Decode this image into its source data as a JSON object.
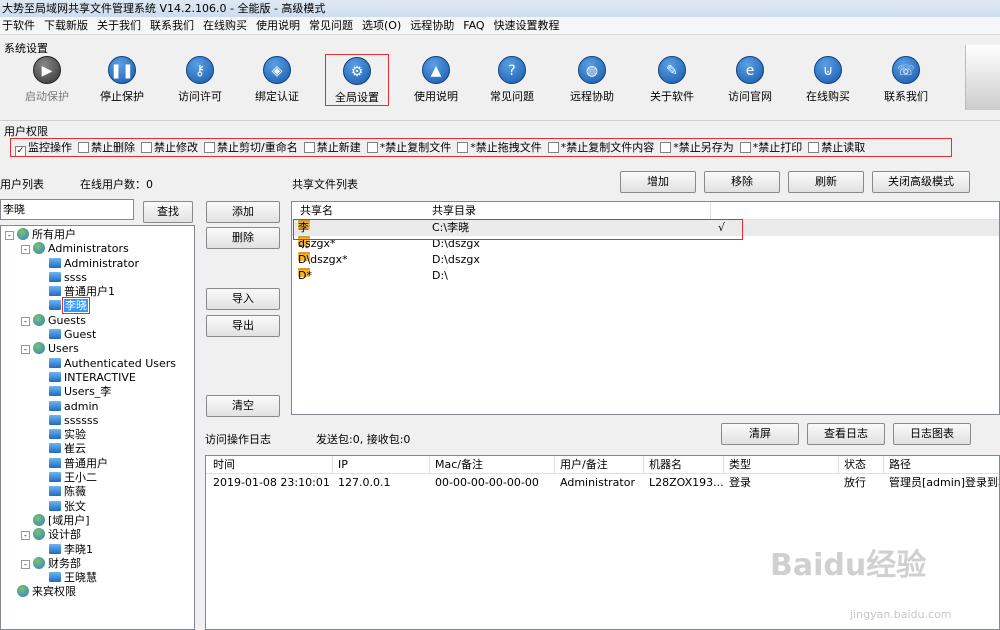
{
  "title": "大势至局域网共享文件管理系统 V14.2.106.0 - 全能版 - 高级模式",
  "menu": [
    "于软件",
    "下载新版",
    "关于我们",
    "联系我们",
    "在线购买",
    "使用说明",
    "常见问题",
    "选项(O)",
    "远程协助",
    "FAQ",
    "快速设置教程"
  ],
  "system_settings_label": "系统设置",
  "toolbar": [
    {
      "label": "启动保护",
      "icon": "play-icon"
    },
    {
      "label": "停止保护",
      "icon": "pause-icon"
    },
    {
      "label": "访问许可",
      "icon": "key-icon"
    },
    {
      "label": "绑定认证",
      "icon": "shield-icon"
    },
    {
      "label": "全局设置",
      "icon": "gear-icon"
    },
    {
      "label": "使用说明",
      "icon": "graduation-cap-icon"
    },
    {
      "label": "常见问题",
      "icon": "question-icon"
    },
    {
      "label": "远程协助",
      "icon": "globe-icon"
    },
    {
      "label": "关于软件",
      "icon": "document-pen-icon"
    },
    {
      "label": "访问官网",
      "icon": "browser-e-icon"
    },
    {
      "label": "在线购买",
      "icon": "cart-icon"
    },
    {
      "label": "联系我们",
      "icon": "phone-icon"
    }
  ],
  "permissions_label": "用户权限",
  "permissions": [
    {
      "label": "监控操作",
      "checked": true
    },
    {
      "label": "禁止删除",
      "checked": false
    },
    {
      "label": "禁止修改",
      "checked": false
    },
    {
      "label": "禁止剪切/重命名",
      "checked": false
    },
    {
      "label": "禁止新建",
      "checked": false
    },
    {
      "label": "*禁止复制文件",
      "checked": false
    },
    {
      "label": "*禁止拖拽文件",
      "checked": false
    },
    {
      "label": "*禁止复制文件内容",
      "checked": false
    },
    {
      "label": "*禁止另存为",
      "checked": false
    },
    {
      "label": "*禁止打印",
      "checked": false
    },
    {
      "label": "禁止读取",
      "checked": false
    }
  ],
  "user_list_label": "用户列表",
  "online_count_label": "在线用户数：0",
  "search_value": "李晓",
  "search_button": "查找",
  "tree": [
    {
      "label": "所有用户",
      "level": 0,
      "type": "group",
      "exp": "-"
    },
    {
      "label": "Administrators",
      "level": 1,
      "type": "group",
      "exp": "-"
    },
    {
      "label": "Administrator",
      "level": 2,
      "type": "user"
    },
    {
      "label": "ssss",
      "level": 2,
      "type": "user"
    },
    {
      "label": "普通用户1",
      "level": 2,
      "type": "user"
    },
    {
      "label": "李晓",
      "level": 2,
      "type": "user",
      "selected": true
    },
    {
      "label": "Guests",
      "level": 1,
      "type": "group",
      "exp": "-"
    },
    {
      "label": "Guest",
      "level": 2,
      "type": "user"
    },
    {
      "label": "Users",
      "level": 1,
      "type": "group",
      "exp": "-"
    },
    {
      "label": "Authenticated Users",
      "level": 2,
      "type": "user"
    },
    {
      "label": "INTERACTIVE",
      "level": 2,
      "type": "user"
    },
    {
      "label": "Users_李",
      "level": 2,
      "type": "user"
    },
    {
      "label": "admin",
      "level": 2,
      "type": "user"
    },
    {
      "label": "ssssss",
      "level": 2,
      "type": "user"
    },
    {
      "label": "实验",
      "level": 2,
      "type": "user"
    },
    {
      "label": "崔云",
      "level": 2,
      "type": "user"
    },
    {
      "label": "普通用户",
      "level": 2,
      "type": "user"
    },
    {
      "label": "王小二",
      "level": 2,
      "type": "user"
    },
    {
      "label": "陈薇",
      "level": 2,
      "type": "user"
    },
    {
      "label": "张文",
      "level": 2,
      "type": "user"
    },
    {
      "label": "[域用户]",
      "level": 1,
      "type": "group"
    },
    {
      "label": "设计部",
      "level": 1,
      "type": "group",
      "exp": "-"
    },
    {
      "label": "李晓1",
      "level": 2,
      "type": "user"
    },
    {
      "label": "财务部",
      "level": 1,
      "type": "group",
      "exp": "-"
    },
    {
      "label": "王晓慧",
      "level": 2,
      "type": "user"
    },
    {
      "label": "来宾权限",
      "level": 0,
      "type": "group"
    }
  ],
  "mid_buttons": {
    "add": "添加",
    "delete": "删除",
    "import": "导入",
    "export": "导出",
    "clear": "清空"
  },
  "share_list_label": "共享文件列表",
  "top_buttons": {
    "add": "增加",
    "remove": "移除",
    "refresh": "刷新",
    "close_adv": "关闭高级模式"
  },
  "share_columns": [
    "共享名",
    "共享目录"
  ],
  "shares": [
    {
      "name": "李晓",
      "path": "C:\\李晓",
      "check": "√"
    },
    {
      "name": "dszgx*",
      "path": "D:\\dszgx",
      "check": ""
    },
    {
      "name": "D\\dszgx*",
      "path": "D:\\dszgx",
      "check": ""
    },
    {
      "name": "D*",
      "path": "D:\\",
      "check": ""
    }
  ],
  "log_label": "访问操作日志",
  "packets_label": "发送包:0, 接收包:0",
  "log_buttons": {
    "clear": "清屏",
    "view": "查看日志",
    "chart": "日志图表"
  },
  "log_columns": [
    "时间",
    "IP",
    "Mac/备注",
    "用户/备注",
    "机器名",
    "类型",
    "状态",
    "路径"
  ],
  "log_rows": [
    [
      "2019-01-08 23:10:01",
      "127.0.0.1",
      "00-00-00-00-00-00",
      "Administrator",
      "L28ZOX193...",
      "登录",
      "放行",
      "管理员[admin]登录到本"
    ]
  ],
  "watermark_text": "Baidu经验",
  "watermark_url": "jingyan.baidu.com",
  "colors": {
    "highlight_border": "#e03030",
    "selection": "#3399ff",
    "title_bg": "#cddcee"
  }
}
